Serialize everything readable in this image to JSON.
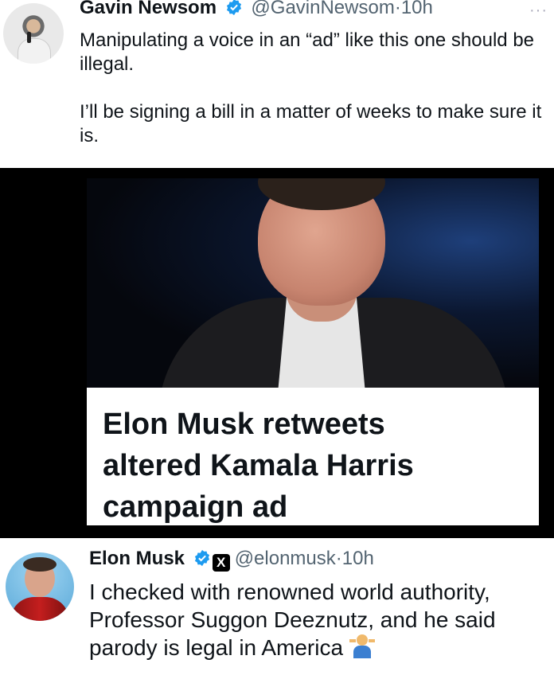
{
  "tweet1": {
    "name": "Gavin Newsom",
    "handle": "@GavinNewsom",
    "separator": "·",
    "time": "10h",
    "more": "···",
    "paragraph1": "Manipulating a voice in an “ad” like this one should be illegal.",
    "paragraph2": "I’ll be signing a bill in a matter of weeks to make sure it is."
  },
  "card": {
    "headline_line1": "Elon Musk retweets",
    "headline_line2": "altered Kamala Harris",
    "headline_line3": "campaign ad"
  },
  "tweet2": {
    "name": "Elon Musk",
    "x_badge": "X",
    "handle": "@elonmusk",
    "separator": "·",
    "time": "10h",
    "text": "I checked with renowned world authority, Professor Suggon Deeznutz, and he said parody is legal in America"
  },
  "colors": {
    "verified": "#1d9bf0",
    "text": "#0f1419",
    "secondary": "#536471"
  },
  "icons": {
    "verified": "verified-badge-icon",
    "shrug": "person-shrugging-emoji"
  }
}
